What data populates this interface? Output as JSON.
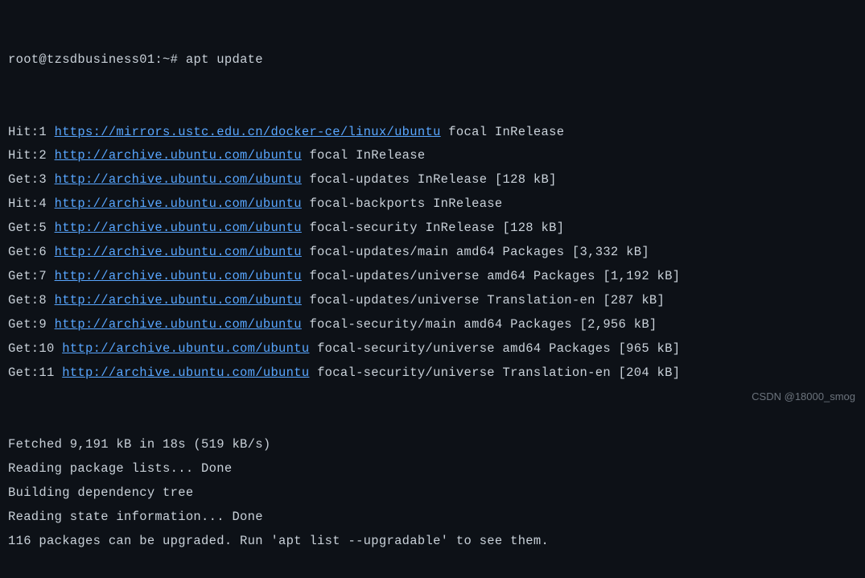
{
  "prompt": {
    "user_host": "root@tzsdbusiness01",
    "cwd": "~",
    "symbol": "#",
    "command": "apt update"
  },
  "lines": [
    {
      "prefix": "Hit:1 ",
      "url": "https://mirrors.ustc.edu.cn/docker-ce/linux/ubuntu",
      "suffix": " focal InRelease"
    },
    {
      "prefix": "Hit:2 ",
      "url": "http://archive.ubuntu.com/ubuntu",
      "suffix": " focal InRelease"
    },
    {
      "prefix": "Get:3 ",
      "url": "http://archive.ubuntu.com/ubuntu",
      "suffix": " focal-updates InRelease [128 kB]"
    },
    {
      "prefix": "Hit:4 ",
      "url": "http://archive.ubuntu.com/ubuntu",
      "suffix": " focal-backports InRelease"
    },
    {
      "prefix": "Get:5 ",
      "url": "http://archive.ubuntu.com/ubuntu",
      "suffix": " focal-security InRelease [128 kB]"
    },
    {
      "prefix": "Get:6 ",
      "url": "http://archive.ubuntu.com/ubuntu",
      "suffix": " focal-updates/main amd64 Packages [3,332 kB]"
    },
    {
      "prefix": "Get:7 ",
      "url": "http://archive.ubuntu.com/ubuntu",
      "suffix": " focal-updates/universe amd64 Packages [1,192 kB]"
    },
    {
      "prefix": "Get:8 ",
      "url": "http://archive.ubuntu.com/ubuntu",
      "suffix": " focal-updates/universe Translation-en [287 kB]"
    },
    {
      "prefix": "Get:9 ",
      "url": "http://archive.ubuntu.com/ubuntu",
      "suffix": " focal-security/main amd64 Packages [2,956 kB]"
    },
    {
      "prefix": "Get:10 ",
      "url": "http://archive.ubuntu.com/ubuntu",
      "suffix": " focal-security/universe amd64 Packages [965 kB]"
    },
    {
      "prefix": "Get:11 ",
      "url": "http://archive.ubuntu.com/ubuntu",
      "suffix": " focal-security/universe Translation-en [204 kB]"
    }
  ],
  "footer": [
    "Fetched 9,191 kB in 18s (519 kB/s)",
    "Reading package lists... Done",
    "Building dependency tree",
    "Reading state information... Done",
    "116 packages can be upgraded. Run 'apt list --upgradable' to see them."
  ],
  "watermark": "CSDN @18000_smog"
}
